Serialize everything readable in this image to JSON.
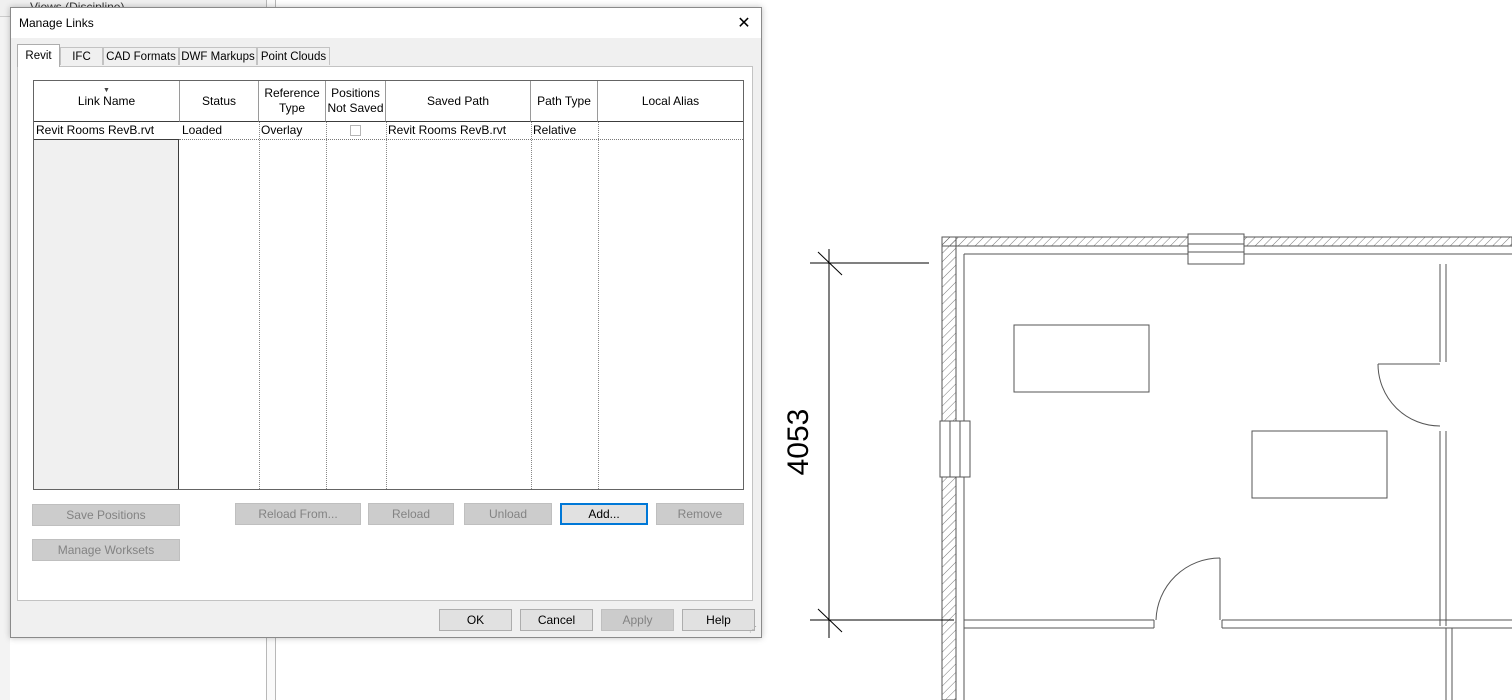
{
  "background": {
    "panel_title": "Views (Discipline)",
    "dimension": "4053"
  },
  "dialog": {
    "title": "Manage Links",
    "close_glyph": "✕",
    "tabs": [
      {
        "label": "Revit",
        "active": true
      },
      {
        "label": "IFC",
        "active": false
      },
      {
        "label": "CAD Formats",
        "active": false
      },
      {
        "label": "DWF Markups",
        "active": false
      },
      {
        "label": "Point Clouds",
        "active": false
      }
    ],
    "table": {
      "columns": [
        {
          "label": "Link Name"
        },
        {
          "label": "Status"
        },
        {
          "label": "Reference\nType"
        },
        {
          "label": "Positions\nNot Saved"
        },
        {
          "label": "Saved Path"
        },
        {
          "label": "Path Type"
        },
        {
          "label": "Local Alias"
        }
      ],
      "rows": [
        {
          "link_name": "Revit Rooms RevB.rvt",
          "status": "Loaded",
          "reference_type": "Overlay",
          "positions_not_saved": false,
          "saved_path": "Revit Rooms RevB.rvt",
          "path_type": "Relative",
          "local_alias": ""
        }
      ]
    },
    "buttons": {
      "save_positions": "Save Positions",
      "manage_worksets": "Manage Worksets",
      "reload_from": "Reload From...",
      "reload": "Reload",
      "unload": "Unload",
      "add": "Add...",
      "remove": "Remove",
      "ok": "OK",
      "cancel": "Cancel",
      "apply": "Apply",
      "help": "Help"
    }
  },
  "colors": {
    "accent": "#0078d7",
    "dialog_bg": "#f0f0f0",
    "disabled_btn": "#cccccc"
  }
}
